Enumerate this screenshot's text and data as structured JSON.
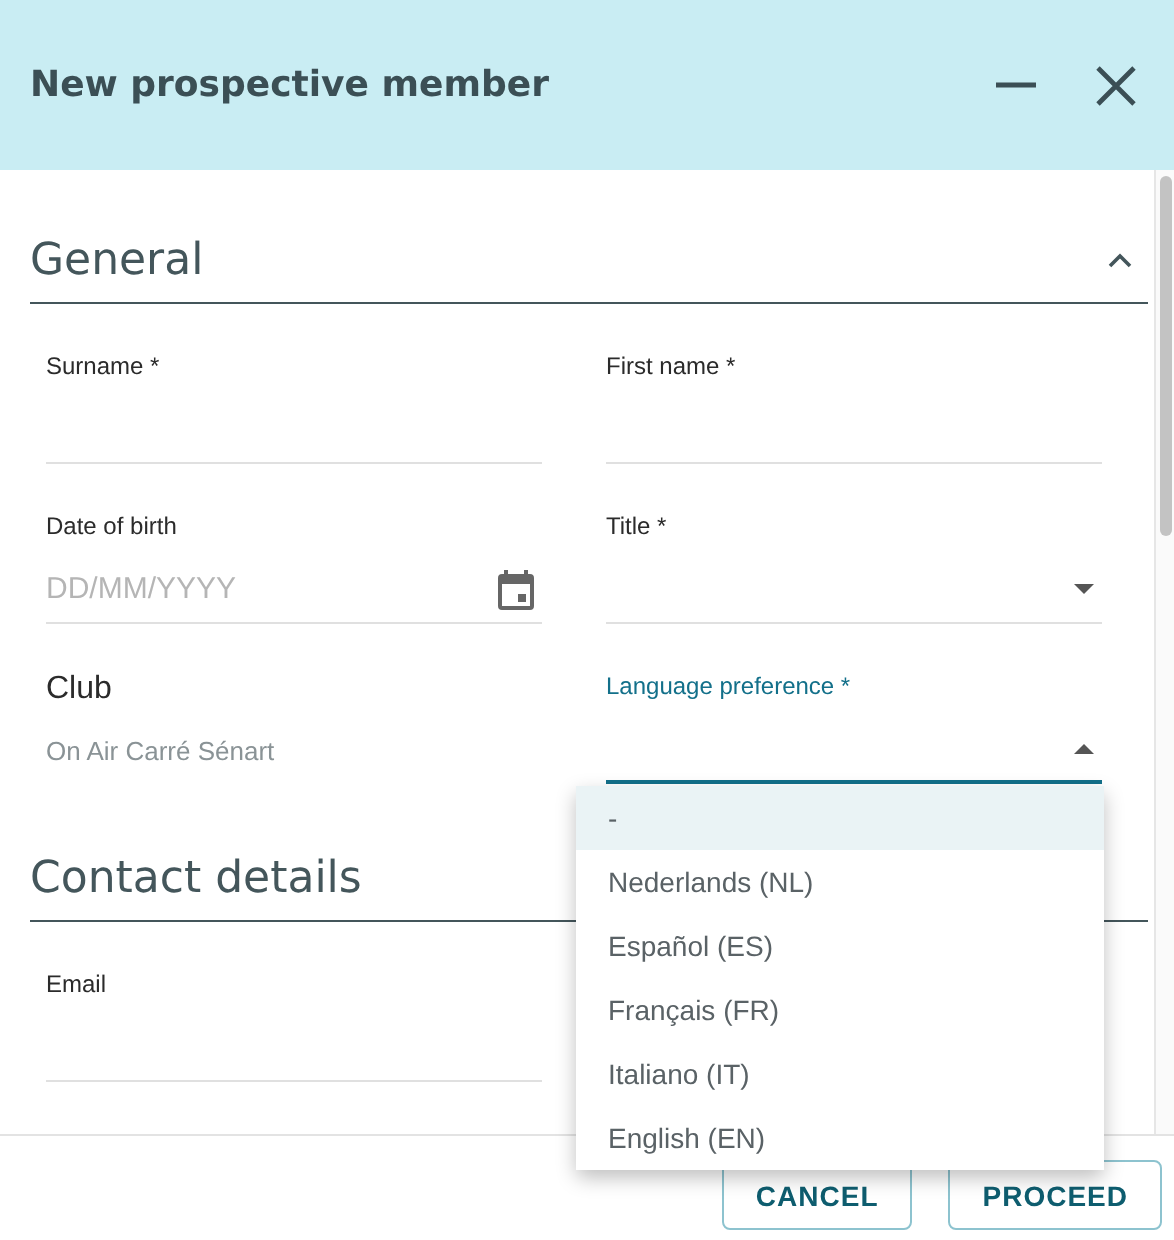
{
  "dialog": {
    "title": "New prospective member"
  },
  "sections": [
    {
      "title": "General",
      "expanded": true,
      "fields": [
        {
          "kind": "text",
          "label": "Surname *"
        },
        {
          "kind": "text",
          "label": "First name *"
        },
        {
          "kind": "date",
          "label": "Date of birth",
          "placeholder": "DD/MM/YYYY"
        },
        {
          "kind": "select",
          "label": "Title *",
          "open": false
        },
        {
          "kind": "static",
          "label": "Club",
          "value": "On Air Carré Sénart"
        },
        {
          "kind": "select",
          "label": "Language preference *",
          "open": true
        }
      ]
    },
    {
      "title": "Contact details",
      "fields": [
        {
          "kind": "text",
          "label": "Email"
        }
      ]
    }
  ],
  "menu": {
    "options": [
      {
        "label": "-",
        "selected": true
      },
      {
        "label": "Nederlands (NL)",
        "selected": false
      },
      {
        "label": "Español (ES)",
        "selected": false
      },
      {
        "label": "Français (FR)",
        "selected": false
      },
      {
        "label": "Italiano (IT)",
        "selected": false
      },
      {
        "label": "English (EN)",
        "selected": false
      }
    ]
  },
  "buttons": [
    "CANCEL",
    "PROCEED"
  ]
}
